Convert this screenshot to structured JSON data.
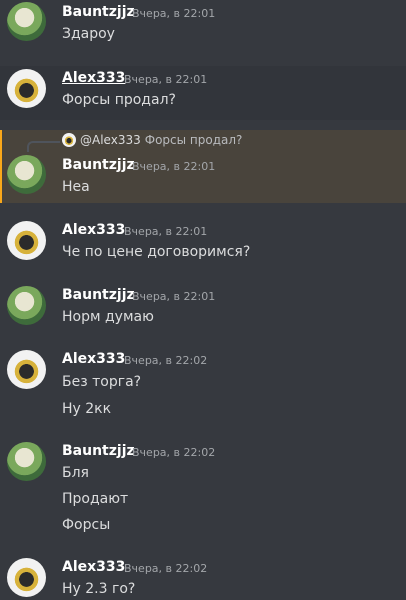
{
  "messages": [
    {
      "user": "Bauntzjjz",
      "time": "Вчера, в 22:01",
      "lines": [
        "Здароу"
      ]
    },
    {
      "user": "Alex333",
      "time": "Вчера, в 22:01",
      "lines": [
        "Форсы продал?"
      ]
    },
    {
      "user": "Bauntzjjz",
      "time": "Вчера, в 22:01",
      "lines": [
        "Неа"
      ],
      "reply": {
        "user": "@Alex333",
        "text": "Форсы продал?"
      }
    },
    {
      "user": "Alex333",
      "time": "Вчера, в 22:01",
      "lines": [
        "Че по цене договоримся?"
      ]
    },
    {
      "user": "Bauntzjjz",
      "time": "Вчера, в 22:01",
      "lines": [
        "Норм думаю"
      ]
    },
    {
      "user": "Alex333",
      "time": "Вчера, в 22:02",
      "lines": [
        "Без торга?",
        "Ну 2кк"
      ]
    },
    {
      "user": "Bauntzjjz",
      "time": "Вчера, в 22:02",
      "lines": [
        "Бля",
        "Продают",
        "Форсы"
      ]
    },
    {
      "user": "Alex333",
      "time": "Вчера, в 22:02",
      "lines": [
        "Ну 2.3 го?"
      ]
    }
  ]
}
